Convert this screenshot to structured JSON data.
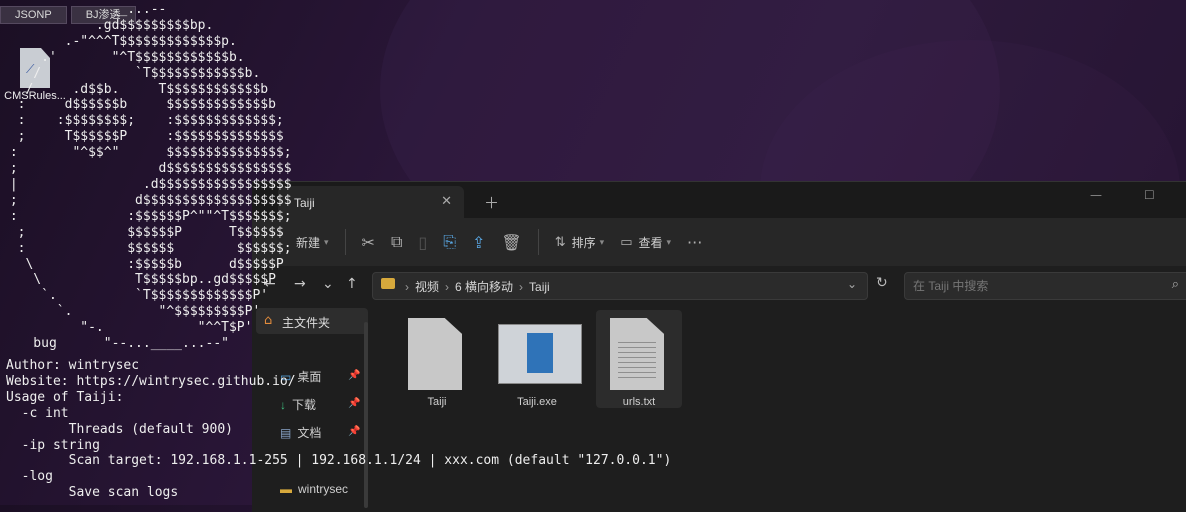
{
  "desktop": {
    "tabs": [
      "JSONP",
      "BJ渗透"
    ],
    "icon_label": "CMSRules..."
  },
  "explorer": {
    "tab_title": "Taiji",
    "toolbar": {
      "new_label": "新建",
      "sort_label": "排序",
      "view_label": "查看",
      "more_glyph": "···"
    },
    "breadcrumbs": [
      "视频",
      "6 横向移动",
      "Taiji"
    ],
    "search_placeholder": "在 Taiji 中搜索",
    "nav": {
      "home": "主文件夹",
      "items": [
        {
          "label": "桌面",
          "icon": "desktop-icon"
        },
        {
          "label": "下载",
          "icon": "download-icon"
        },
        {
          "label": "文档",
          "icon": "document-icon"
        },
        {
          "label": "wintrysec",
          "icon": "folder-icon"
        }
      ]
    },
    "files": [
      {
        "name": "Taiji",
        "type": "file"
      },
      {
        "name": "Taiji.exe",
        "type": "exe"
      },
      {
        "name": "urls.txt",
        "type": "txt"
      }
    ]
  },
  "terminal": {
    "ascii_art": "              __...--\n            .gd$$$$$$$$$bp.\n        .-\"^^^T$$$$$$$$$$$$$p.\n     .'       \"^T$$$$$$$$$$$$b.\n    /            `T$$$$$$$$$$$$b.\n   /     .d$$b.     T$$$$$$$$$$$$b\n  :     d$$$$$$b     $$$$$$$$$$$$$b\n  :    :$$$$$$$$;    :$$$$$$$$$$$$$;\n  ;     T$$$$$$P     :$$$$$$$$$$$$$$\n :       \"^$$^\"      $$$$$$$$$$$$$$$;\n ;                  d$$$$$$$$$$$$$$$$\n |                .d$$$$$$$$$$$$$$$$$\n ;               d$$$$$$$$$$$$$$$$$$$\n :              :$$$$$$P^\"\"^T$$$$$$$;\n  ;             $$$$$$P      T$$$$$$\n  :             $$$$$$        $$$$$$;\n   \\            :$$$$$b      d$$$$$P\n    \\            T$$$$$bp..gd$$$$$P\n     `.          `T$$$$$$$$$$$$$P'\n       `.           \"^$$$$$$$$$P'\n          \"-.            \"^^T$P'\n    bug      \"--...____...--\"",
    "help_text": "Author: wintrysec\nWebsite: https://wintrysec.github.io/\nUsage of Taiji:\n  -c int\n        Threads (default 900)\n  -ip string\n        Scan target: 192.168.1.1-255 | 192.168.1.1/24 | xxx.com (default \"127.0.0.1\")\n  -log\n        Save scan logs"
  }
}
